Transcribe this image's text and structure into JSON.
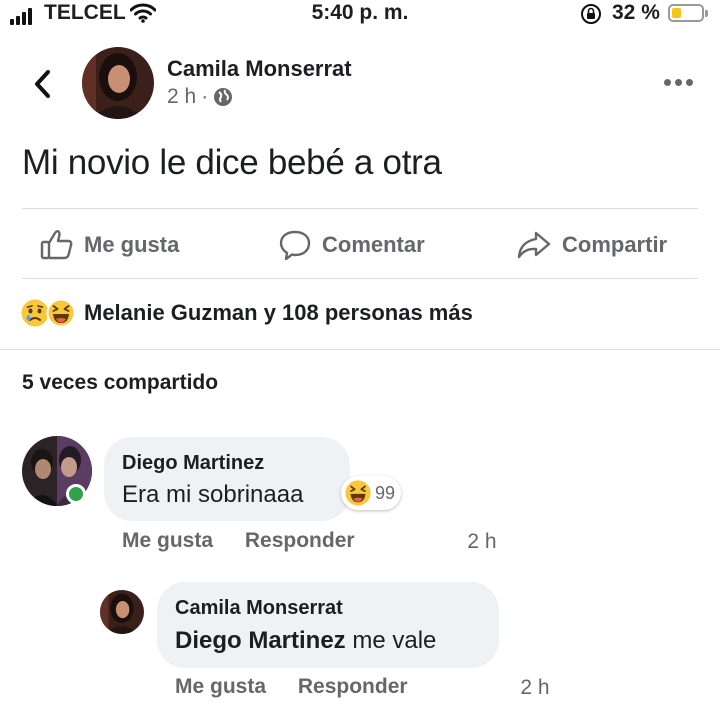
{
  "status_bar": {
    "carrier": "TELCEL",
    "time": "5:40 p. m.",
    "battery_percent": "32 %",
    "battery_level": 0.32
  },
  "post": {
    "author": "Camila Monserrat",
    "time": "2 h",
    "separator": "·",
    "text": "Mi novio le dice bebé a otra",
    "actions": {
      "like": "Me gusta",
      "comment": "Comentar",
      "share": "Compartir"
    },
    "reactions_summary": "Melanie Guzman y 108 personas más",
    "reaction_icons": [
      "sad-emoji-icon",
      "haha-emoji-icon"
    ],
    "shares": "5 veces compartido"
  },
  "comments": [
    {
      "author": "Diego Martinez",
      "text": "Era mi sobrinaaa",
      "reaction_icon": "haha-emoji-icon",
      "reaction_count": "99",
      "time": "2 h",
      "like": "Me gusta",
      "reply": "Responder",
      "online": true
    },
    {
      "author": "Camila Monserrat",
      "mention": "Diego Martinez",
      "text": " me vale",
      "time": "2 h",
      "like": "Me gusta",
      "reply": "Responder"
    }
  ],
  "colors": {
    "text": "#1c1e21",
    "secondary": "#65676b",
    "bubble": "#eff2f5",
    "divider": "#dadde1",
    "online": "#31a24c",
    "battery": "#f5c518",
    "emoji_yellow": "#f7c73c"
  }
}
